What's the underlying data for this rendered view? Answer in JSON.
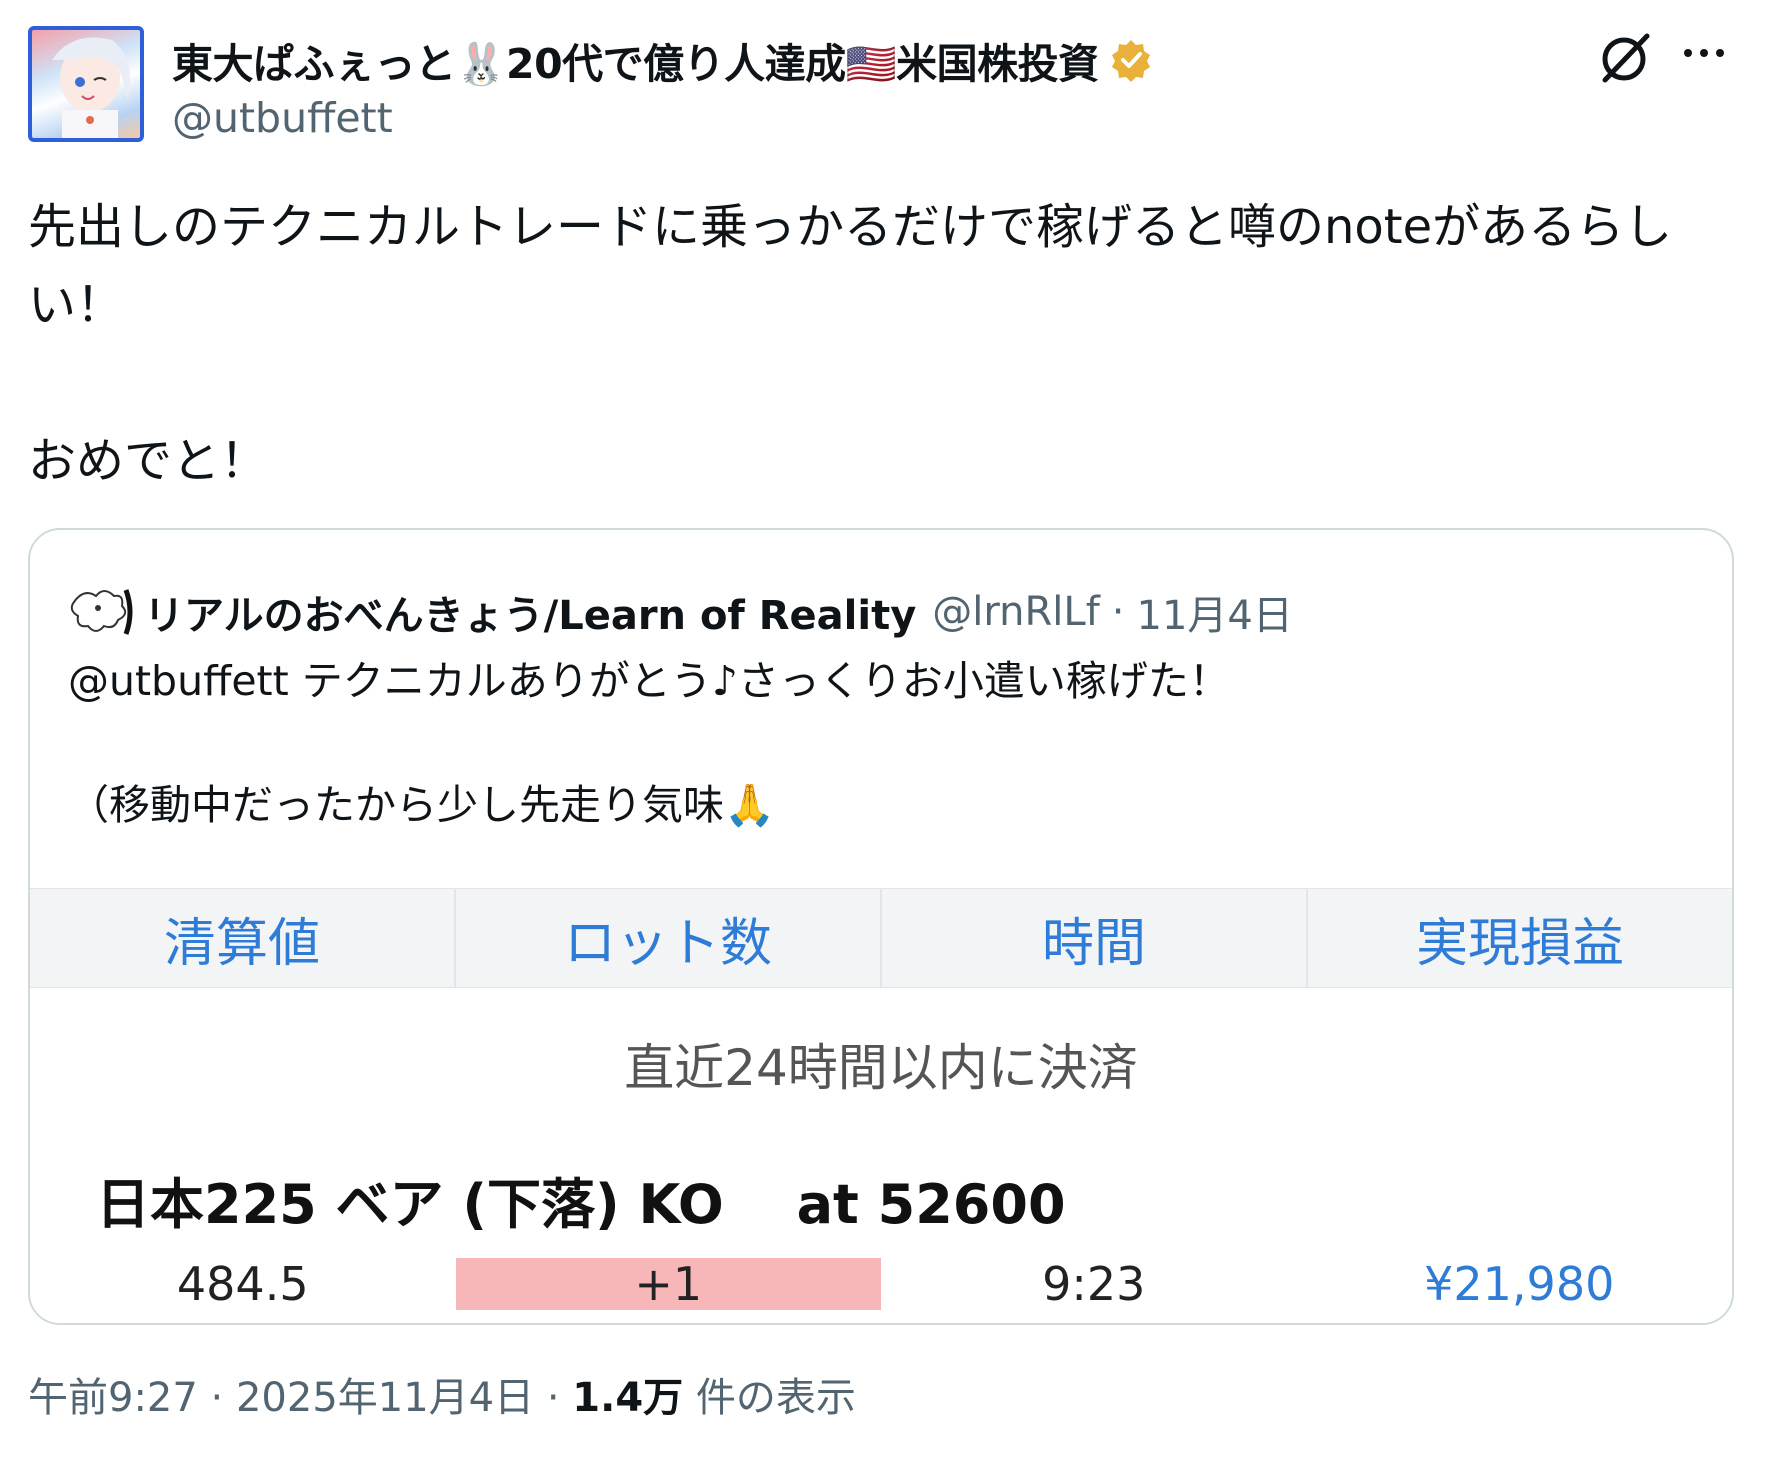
{
  "tweet": {
    "author_name": "東大ぱふぇっと🐰20代で億り人達成🇺🇸米国株投資",
    "handle": "@utbuffett",
    "text": "先出しのテクニカルトレードに乗っかるだけで稼げると噂のnoteがあるらしい！\n\nおめでと！",
    "icons": [
      "avatar",
      "verified-badge-icon",
      "grok-icon",
      "more-icon"
    ]
  },
  "quote": {
    "author_name": "リアルのおべんきょう/Learn of Reality",
    "handle": "@lrnRlLf",
    "separator": "·",
    "date": "11月4日",
    "text": "@utbuffett テクニカルありがとう♪さっくりお小遣い稼げた！\n\n（移動中だったから少し先走り気味🙏",
    "screenshot": {
      "columns": [
        "清算値",
        "ロット数",
        "時間",
        "実現損益"
      ],
      "section_label": "直近24時間以内に決済",
      "instrument": "日本225 ベア (下落) KO　 at 52600",
      "row": {
        "settlement": "484.5",
        "lots": "+1",
        "time": "9:23",
        "pnl": "¥21,980"
      },
      "colors": {
        "header_text": "#2e7cd6",
        "lot_bg": "#f7b7b8",
        "pnl": "#2e7cd6"
      }
    }
  },
  "footer": {
    "time": "午前9:27",
    "sep1": " · ",
    "date": "2025年11月4日",
    "sep2": " · ",
    "views_count": "1.4万",
    "views_label": " 件の表示"
  }
}
